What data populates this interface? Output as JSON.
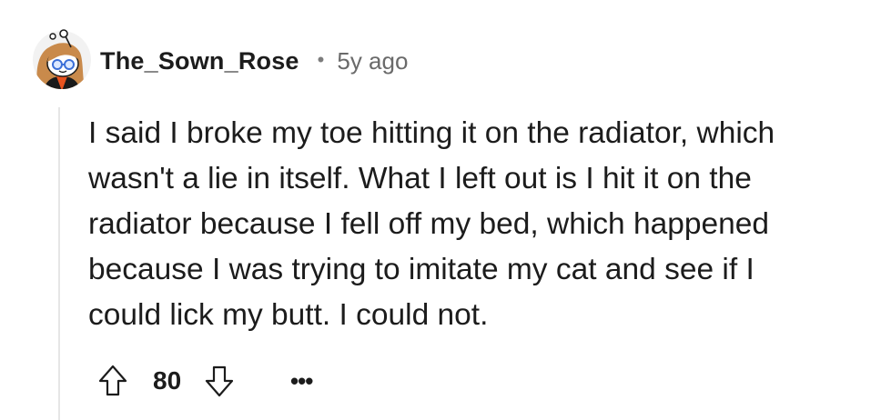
{
  "comment": {
    "username": "The_Sown_Rose",
    "separator": "•",
    "timestamp": "5y ago",
    "avatar_icon": "snoo-avatar-icon",
    "body_lines": [
      "I said I broke my toe hitting it on the radiator, which",
      "wasn't a lie in itself. What I left out is I hit it on the",
      "radiator because I fell off my bed, which happened",
      "because I was trying to imitate my cat and see if I",
      "could lick my butt. I could not."
    ],
    "score": "80",
    "upvote_icon": "arrow-up-icon",
    "downvote_icon": "arrow-down-icon",
    "more_label": "•••"
  },
  "colors": {
    "text": "#1c1c1c",
    "muted": "#6a6a6a",
    "thread_line": "#e6e6e6",
    "avatar_bg": "#f2f2f2",
    "hair": "#c98a4b",
    "shirt": "#e8531f"
  }
}
